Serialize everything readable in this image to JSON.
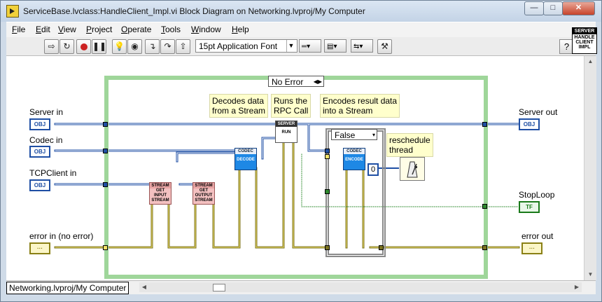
{
  "window": {
    "title": "ServiceBase.lvclass:HandleClient_Impl.vi Block Diagram on Networking.lvproj/My Computer",
    "minimize": "—",
    "maximize": "□",
    "close": "✕"
  },
  "menu": [
    "File",
    "Edit",
    "View",
    "Project",
    "Operate",
    "Tools",
    "Window",
    "Help"
  ],
  "toolbar": {
    "font": "15pt Application Font",
    "help": "?",
    "icons": [
      "run-arrow-icon",
      "run-continuous-icon",
      "abort-icon",
      "pause-icon",
      "highlight-execution-icon",
      "retain-wire-values-icon",
      "step-into-icon",
      "step-over-icon",
      "step-out-icon",
      "align-icon",
      "distribute-icon",
      "reorder-icon",
      "cleanup-icon"
    ]
  },
  "vi_icon": {
    "band": "SERVER",
    "text": [
      "HANDLE",
      "CLIENT",
      "IMPL"
    ]
  },
  "case_structure": {
    "selector": "No Error"
  },
  "inner_case": {
    "selector": "False"
  },
  "controls": [
    {
      "label": "Server in",
      "tag": "OBJ"
    },
    {
      "label": "Codec in",
      "tag": "OBJ"
    },
    {
      "label": "TCPClient in",
      "tag": "OBJ"
    },
    {
      "label": "error in (no error)",
      "tag": "···"
    }
  ],
  "indicators": [
    {
      "label": "Server out",
      "tag": "OBJ"
    },
    {
      "label": "StopLoop",
      "tag": "TF"
    },
    {
      "label": "error out",
      "tag": "···"
    }
  ],
  "comments": {
    "decode": [
      "Decodes data",
      "from a Stream"
    ],
    "rpc": [
      "Runs the",
      "RPC Call"
    ],
    "encode": [
      "Encodes result data",
      "into a Stream"
    ],
    "reschedule": [
      "reschedule",
      "thread"
    ]
  },
  "nodes": {
    "get_input": {
      "head": "STREAM",
      "body": [
        "GET",
        "INPUT",
        "STREAM"
      ]
    },
    "get_output": {
      "head": "STREAM",
      "body": [
        "GET",
        "OUTPUT",
        "STREAM"
      ]
    },
    "decode": {
      "head": "CODEC",
      "body": "DECODE"
    },
    "run": {
      "head": "SERVER",
      "body": "RUN"
    },
    "encode": {
      "head": "CODEC",
      "body": "ENCODE"
    }
  },
  "constant": "0",
  "status": {
    "path": "Networking.lvproj/My Computer"
  }
}
